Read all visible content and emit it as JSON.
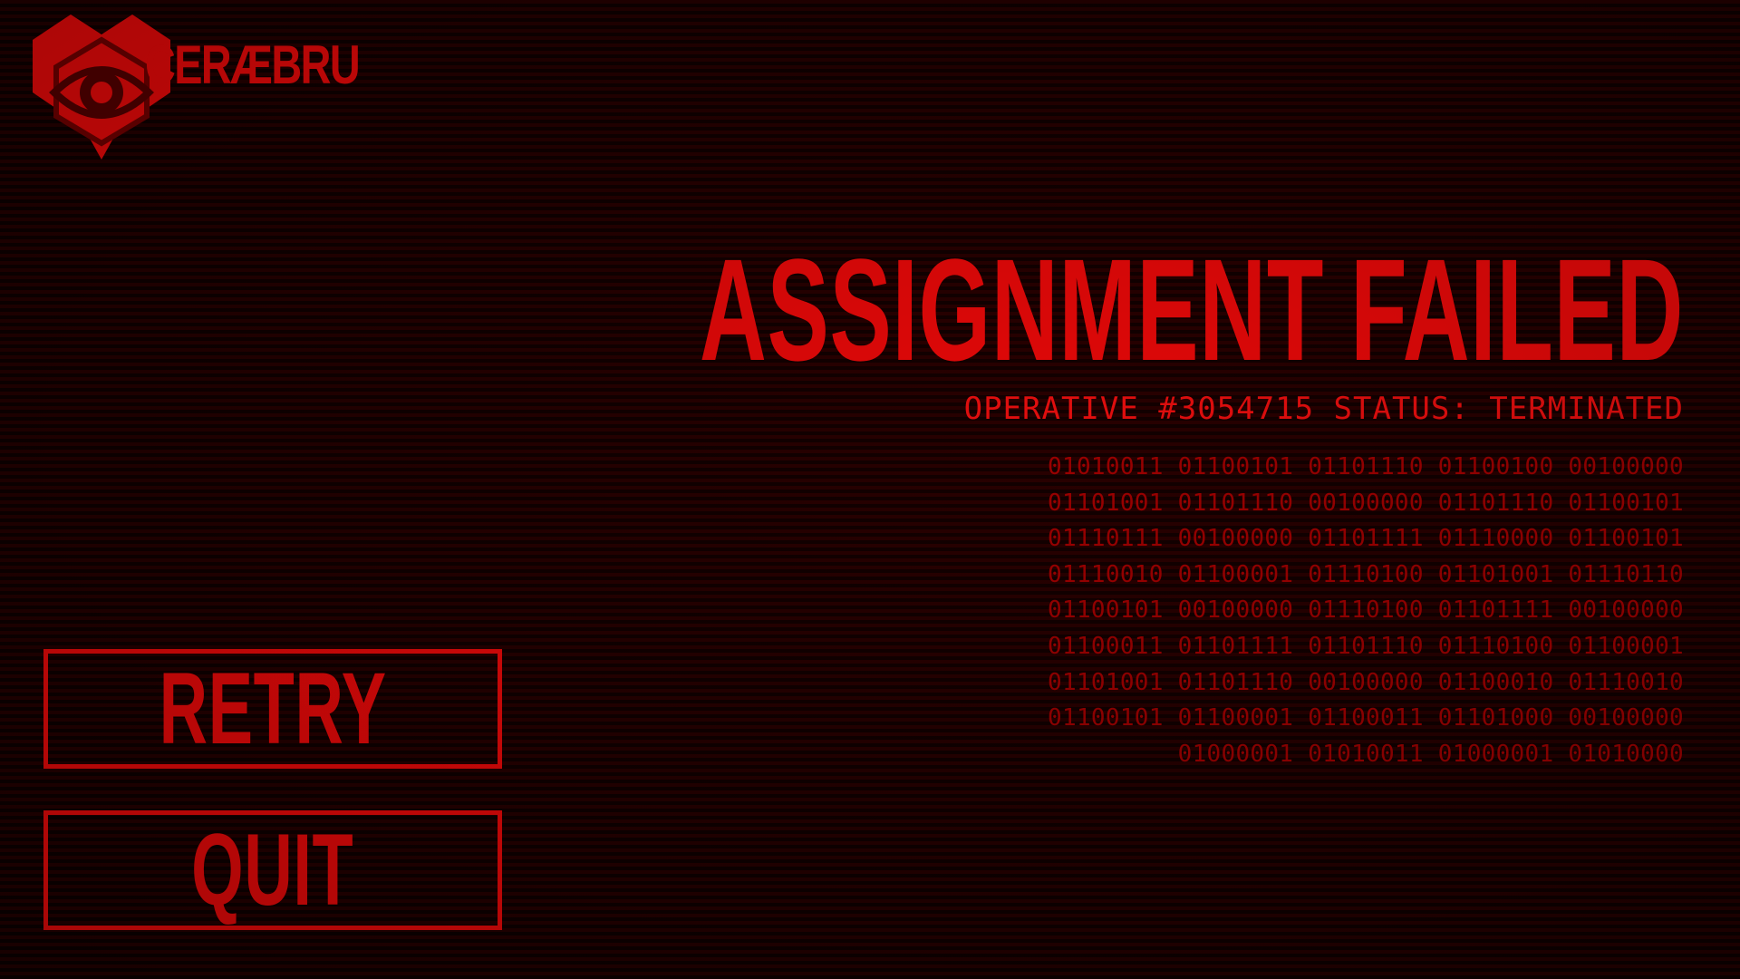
{
  "brand": {
    "name": "CERÆBRU",
    "logo_icon": "eye-hexagon-icon"
  },
  "screen": {
    "title": "ASSIGNMENT FAILED",
    "status": "OPERATIVE #3054715 STATUS: TERMINATED",
    "binary_rows": [
      "01010011 01100101 01101110 01100100 00100000",
      "01101001 01101110 00100000 01101110 01100101",
      "01110111 00100000 01101111 01110000 01100101",
      "01110010 01100001 01110100 01101001 01110110",
      "01100101 00100000 01110100 01101111 00100000",
      "01100011 01101111 01101110 01110100 01100001",
      "01101001 01101110 00100000 01100010 01110010",
      "01100101 01100001 01100011 01101000 00100000",
      "01000001 01010011 01000001 01010000"
    ]
  },
  "menu": {
    "retry_label": "RETRY",
    "quit_label": "QUIT"
  },
  "colors": {
    "accent": "#ff0a0a",
    "binary": "#c40000",
    "background_dark": "#0c0000",
    "background_line": "#250000"
  }
}
